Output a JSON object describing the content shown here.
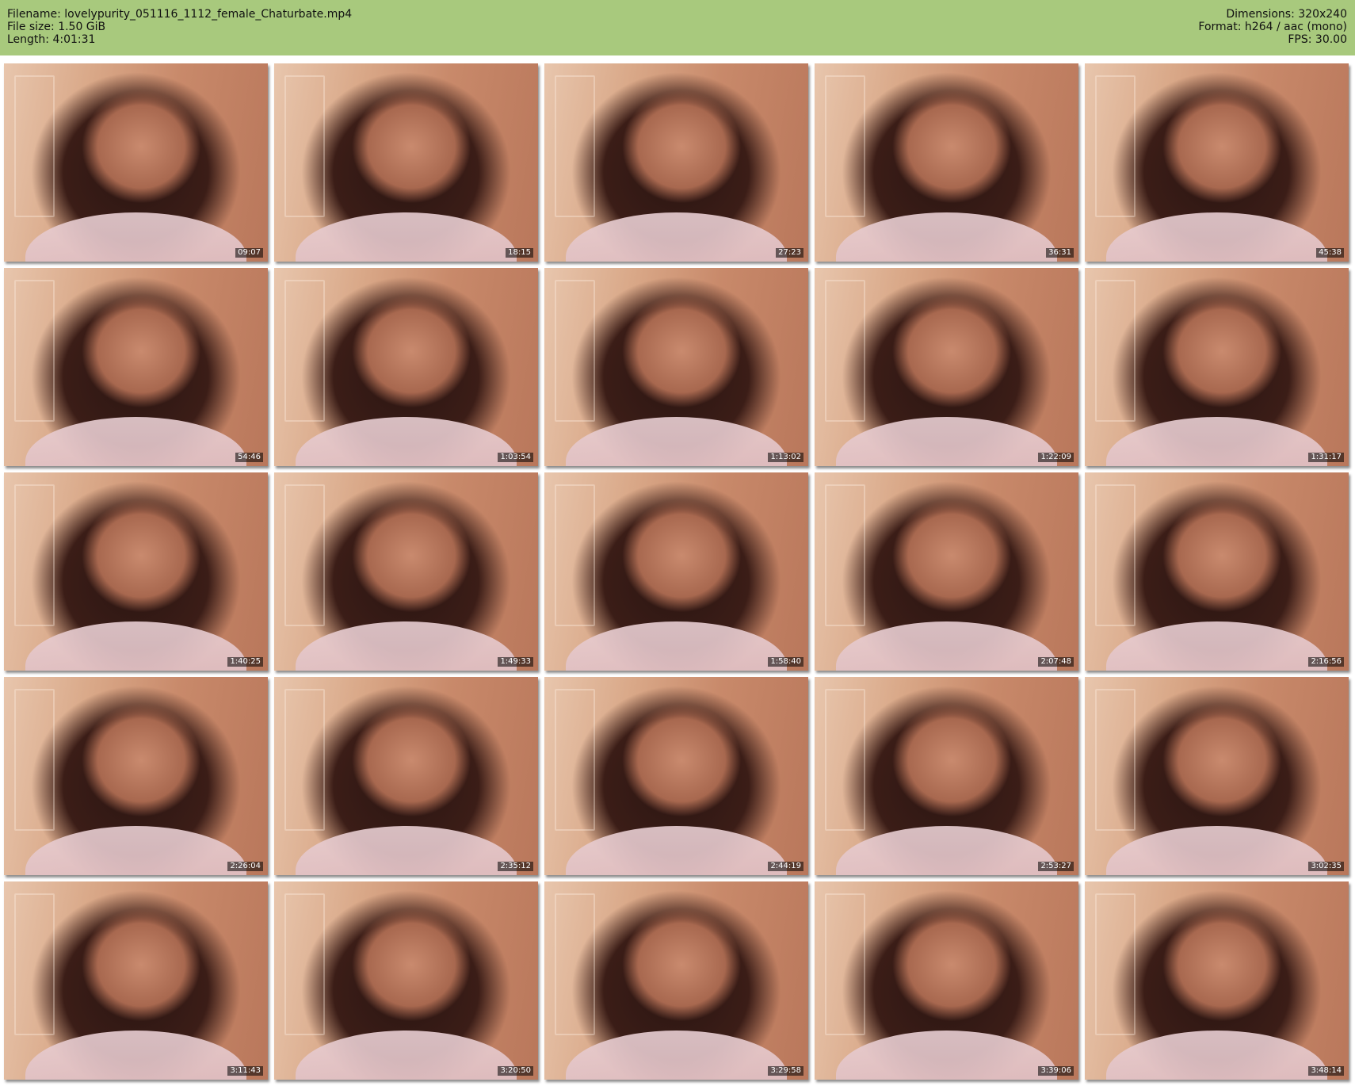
{
  "header": {
    "filename": "Filename: lovelypurity_051116_1112_female_Chaturbate.mp4",
    "filesize": "File size: 1.50 GiB",
    "length": "Length: 4:01:31",
    "dimensions": "Dimensions: 320x240",
    "format": "Format: h264 / aac (mono)",
    "fps": "FPS: 30.00"
  },
  "colors": {
    "header_bg": "#a8c97d"
  },
  "thumbnails": [
    {
      "time": "09:07"
    },
    {
      "time": "18:15"
    },
    {
      "time": "27:23"
    },
    {
      "time": "36:31"
    },
    {
      "time": "45:38"
    },
    {
      "time": "54:46"
    },
    {
      "time": "1:03:54"
    },
    {
      "time": "1:13:02"
    },
    {
      "time": "1:22:09"
    },
    {
      "time": "1:31:17"
    },
    {
      "time": "1:40:25"
    },
    {
      "time": "1:49:33"
    },
    {
      "time": "1:58:40"
    },
    {
      "time": "2:07:48"
    },
    {
      "time": "2:16:56"
    },
    {
      "time": "2:26:04"
    },
    {
      "time": "2:35:12"
    },
    {
      "time": "2:44:19"
    },
    {
      "time": "2:53:27"
    },
    {
      "time": "3:02:35"
    },
    {
      "time": "3:11:43"
    },
    {
      "time": "3:20:50"
    },
    {
      "time": "3:29:58"
    },
    {
      "time": "3:39:06"
    },
    {
      "time": "3:48:14"
    }
  ]
}
